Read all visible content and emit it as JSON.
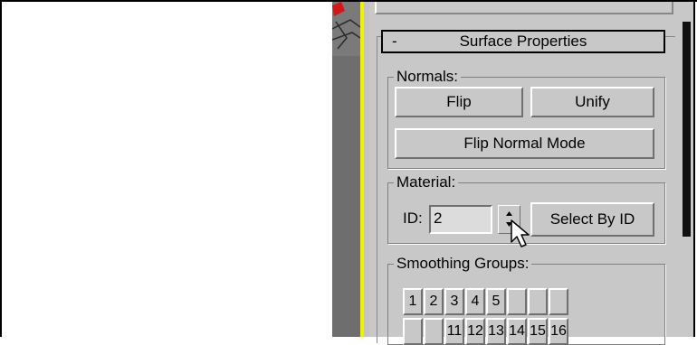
{
  "rollout": {
    "collapse_symbol": "-",
    "title": "Surface Properties"
  },
  "normals": {
    "label": "Normals:",
    "flip": "Flip",
    "unify": "Unify",
    "flip_normal_mode": "Flip Normal Mode"
  },
  "material": {
    "label": "Material:",
    "id_label": "ID:",
    "id_value": "2",
    "select_by_id": "Select By ID"
  },
  "smoothing": {
    "label": "Smoothing Groups:",
    "row1": [
      "1",
      "2",
      "3",
      "4",
      "5",
      "",
      "",
      ""
    ],
    "row2": [
      "",
      "",
      "11",
      "12",
      "13",
      "14",
      "15",
      "16"
    ]
  },
  "icons": {
    "cursor": "mouse-pointer-icon",
    "spinner_up": "triangle-up-icon",
    "spinner_down": "triangle-down-icon"
  },
  "colors": {
    "viewport_border": "#f2f200",
    "panel_bg": "#c8c8c8",
    "viewport_bg": "#6e6e6e"
  }
}
